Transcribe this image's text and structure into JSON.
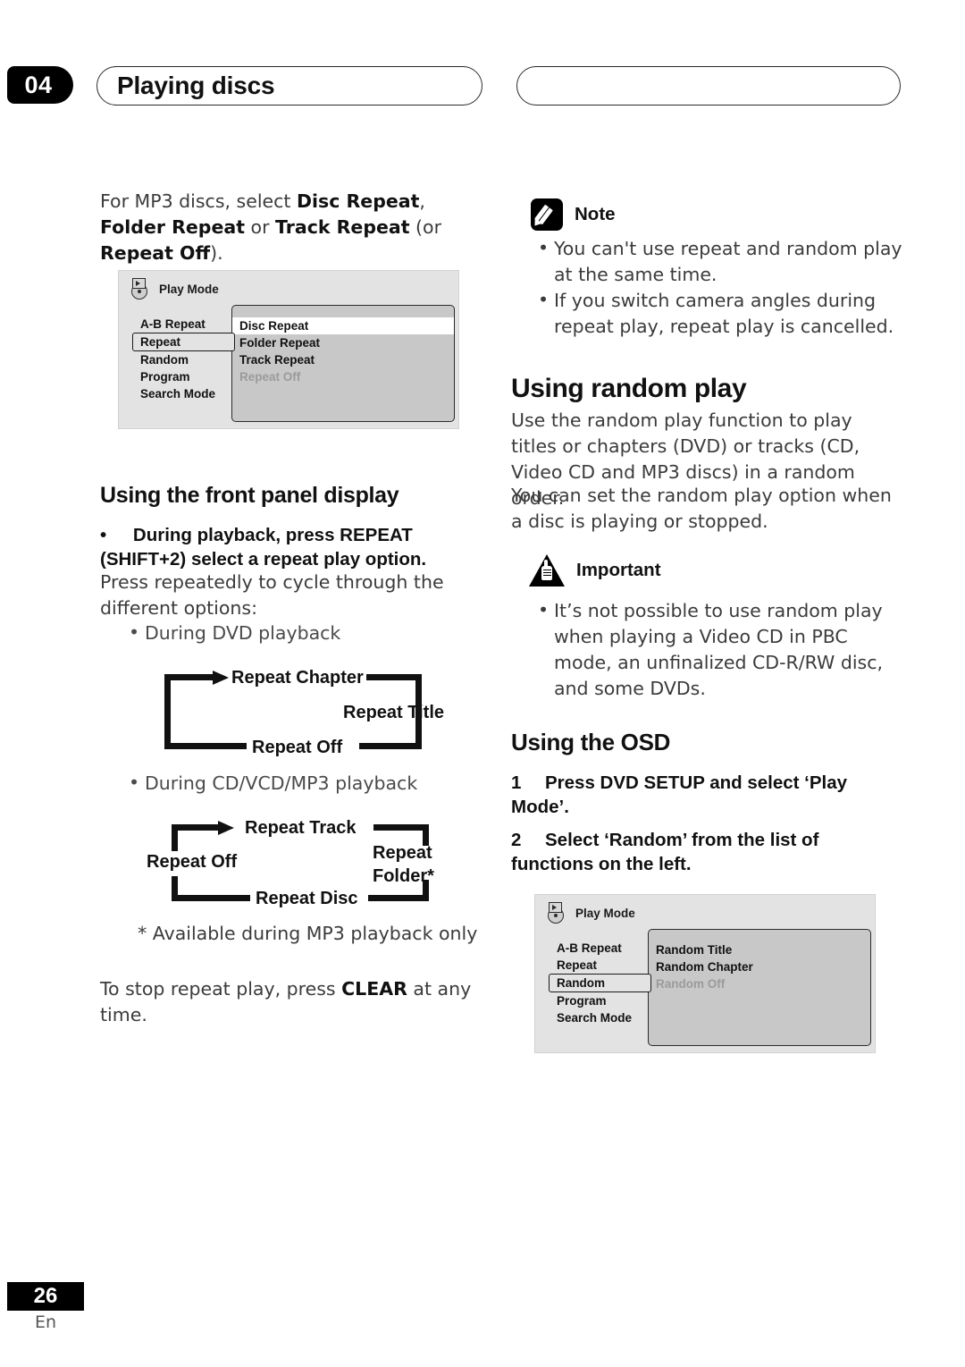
{
  "header": {
    "chapter_number": "04",
    "chapter_title": "Playing discs",
    "right_pill_title": ""
  },
  "footer": {
    "page_number": "26",
    "language": "En"
  },
  "left_column": {
    "intro": {
      "part1": "For MP3 discs, select ",
      "b1": "Disc Repeat",
      "part2": ", ",
      "b2": "Folder Repeat",
      "part3": " or ",
      "b3": "Track Repeat",
      "part4": " (or ",
      "b4": "Repeat Off",
      "part5": ")."
    },
    "osd_repeat": {
      "title": "Play Mode",
      "menu": [
        "A-B Repeat",
        "Repeat",
        "Random",
        "Program",
        "Search Mode"
      ],
      "selected_menu": "Repeat",
      "options": [
        "Disc Repeat",
        "Folder Repeat",
        "Track Repeat",
        "Repeat Off"
      ],
      "highlighted_option": "Disc Repeat",
      "dimmed_option": "Repeat Off"
    },
    "front_panel_heading": "Using the front panel display",
    "front_panel_step_bullet": "•",
    "front_panel_step_line1": "During playback, press REPEAT",
    "front_panel_step_line2": "(SHIFT+2) select a repeat play option.",
    "front_panel_body": "Press repeatedly to cycle through the different options:",
    "dvd_bullet": "During DVD playback",
    "dvd_cycle": {
      "top": "Repeat Chapter",
      "right": "Repeat Title",
      "bottom": "Repeat Off"
    },
    "cd_bullet": "During CD/VCD/MP3 playback",
    "cd_cycle": {
      "top": "Repeat Track",
      "right_line1": "Repeat",
      "right_line2": "Folder*",
      "bottom": "Repeat Disc",
      "left": "Repeat Off"
    },
    "footnote": "* Available during MP3 playback only",
    "clear_note": {
      "part1": "To stop repeat play, press ",
      "b1": "CLEAR",
      "part2": " at any time."
    }
  },
  "right_column": {
    "note": {
      "title": "Note",
      "bullets": [
        "You can't use repeat and random play at the same time.",
        "If you switch camera angles during repeat play, repeat play is cancelled."
      ]
    },
    "random_heading": "Using random play",
    "random_para1": "Use the random play function to play titles or chapters (DVD) or tracks (CD, Video CD and MP3 discs) in a random order.",
    "random_para2": "You can set the random play option when a disc is playing or stopped.",
    "important": {
      "title": "Important",
      "bullets": [
        "It’s not possible to use random play when playing a Video CD in PBC mode, an unfinalized CD-R/RW disc, and some DVDs."
      ]
    },
    "osd_heading": "Using the OSD",
    "steps": [
      {
        "num": "1",
        "text": "Press DVD SETUP and select ‘Play Mode’."
      },
      {
        "num": "2",
        "text": "Select ‘Random’ from the list of functions on the left."
      }
    ],
    "osd_random": {
      "title": "Play Mode",
      "menu": [
        "A-B Repeat",
        "Repeat",
        "Random",
        "Program",
        "Search Mode"
      ],
      "selected_menu": "Random",
      "options": [
        "Random Title",
        "Random Chapter",
        "Random Off"
      ],
      "dimmed_option": "Random Off"
    }
  },
  "colors": {
    "ink": "#231f20",
    "body": "#3b3b3b",
    "osd_bg": "#e3e3e3",
    "osd_panel": "#c8c8c8",
    "highlight": "#ffffff",
    "dim": "#9b9b9b"
  }
}
